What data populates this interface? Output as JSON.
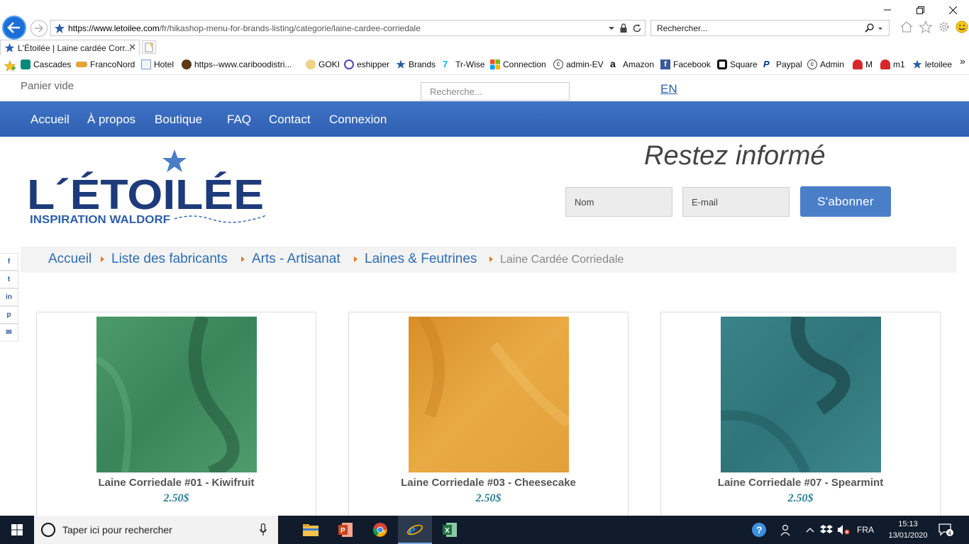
{
  "browser": {
    "url_domain": "https://www.letoilee.com",
    "url_path": "/fr/hikashop-menu-for-brands-listing/categorie/laine-cardee-corriedale",
    "search_placeholder": "Rechercher...",
    "tab_title": "L'Étoilée | Laine cardée Corr...",
    "favorites": [
      "Cascades",
      "FrancoNord",
      "Hotel",
      "https--www.cariboodistri...",
      "GOKI",
      "eshipper",
      "Brands",
      "Tr-Wise",
      "Connection",
      "admin-EV",
      "Amazon",
      "Facebook",
      "Square",
      "Paypal",
      "Admin",
      "M",
      "m1",
      "letoilee"
    ],
    "overflow": "»"
  },
  "site": {
    "cart": "Panier vide",
    "search_placeholder": "Recherche...",
    "lang": "EN",
    "nav": [
      "Accueil",
      "À propos",
      "Boutique",
      "FAQ",
      "Contact",
      "Connexion"
    ],
    "logo_main": "L´ÉTOILÉE",
    "logo_sub": "INSPIRATION WALDORF",
    "newsletter": {
      "title": "Restez informé",
      "name_placeholder": "Nom",
      "email_placeholder": "E-mail",
      "button": "S'abonner"
    },
    "social": [
      "f",
      "t",
      "in",
      "p",
      "✉"
    ],
    "breadcrumb": [
      "Accueil",
      "Liste des fabricants",
      "Arts - Artisanat",
      "Laines & Feutrines"
    ],
    "breadcrumb_current": "Laine Cardée Corriedale",
    "products": [
      {
        "name": "Laine Corriedale #01 - Kiwifruit",
        "price": "2.50$",
        "color": "#3f8a5c"
      },
      {
        "name": "Laine Corriedale #03 - Cheesecake",
        "price": "2.50$",
        "color": "#e3a23a"
      },
      {
        "name": "Laine Corriedale #07 - Spearmint",
        "price": "2.50$",
        "color": "#2f7479"
      }
    ]
  },
  "taskbar": {
    "search_placeholder": "Taper ici pour rechercher",
    "lang": "FRA",
    "time": "15:13",
    "date": "13/01/2020",
    "notifications": "4"
  }
}
